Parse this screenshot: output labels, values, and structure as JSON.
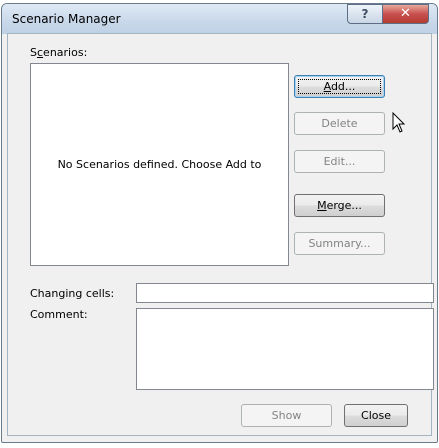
{
  "window": {
    "title": "Scenario Manager",
    "help_glyph": "?",
    "close_glyph": "✕"
  },
  "scenarios": {
    "label_access_key": "c",
    "label_prefix": "S",
    "label_suffix": "enarios:",
    "empty_message": "No Scenarios defined. Choose Add to"
  },
  "buttons": {
    "add": {
      "underlined": "A",
      "rest": "dd..."
    },
    "delete": "Delete",
    "edit": "Edit...",
    "merge": {
      "underlined": "M",
      "rest": "erge..."
    },
    "summary": "Summary..."
  },
  "details": {
    "changing_cells_label": "Changing cells:",
    "changing_cells_value": "",
    "comment_label": "Comment:",
    "comment_value": ""
  },
  "footer": {
    "show": "Show",
    "close": "Close"
  }
}
